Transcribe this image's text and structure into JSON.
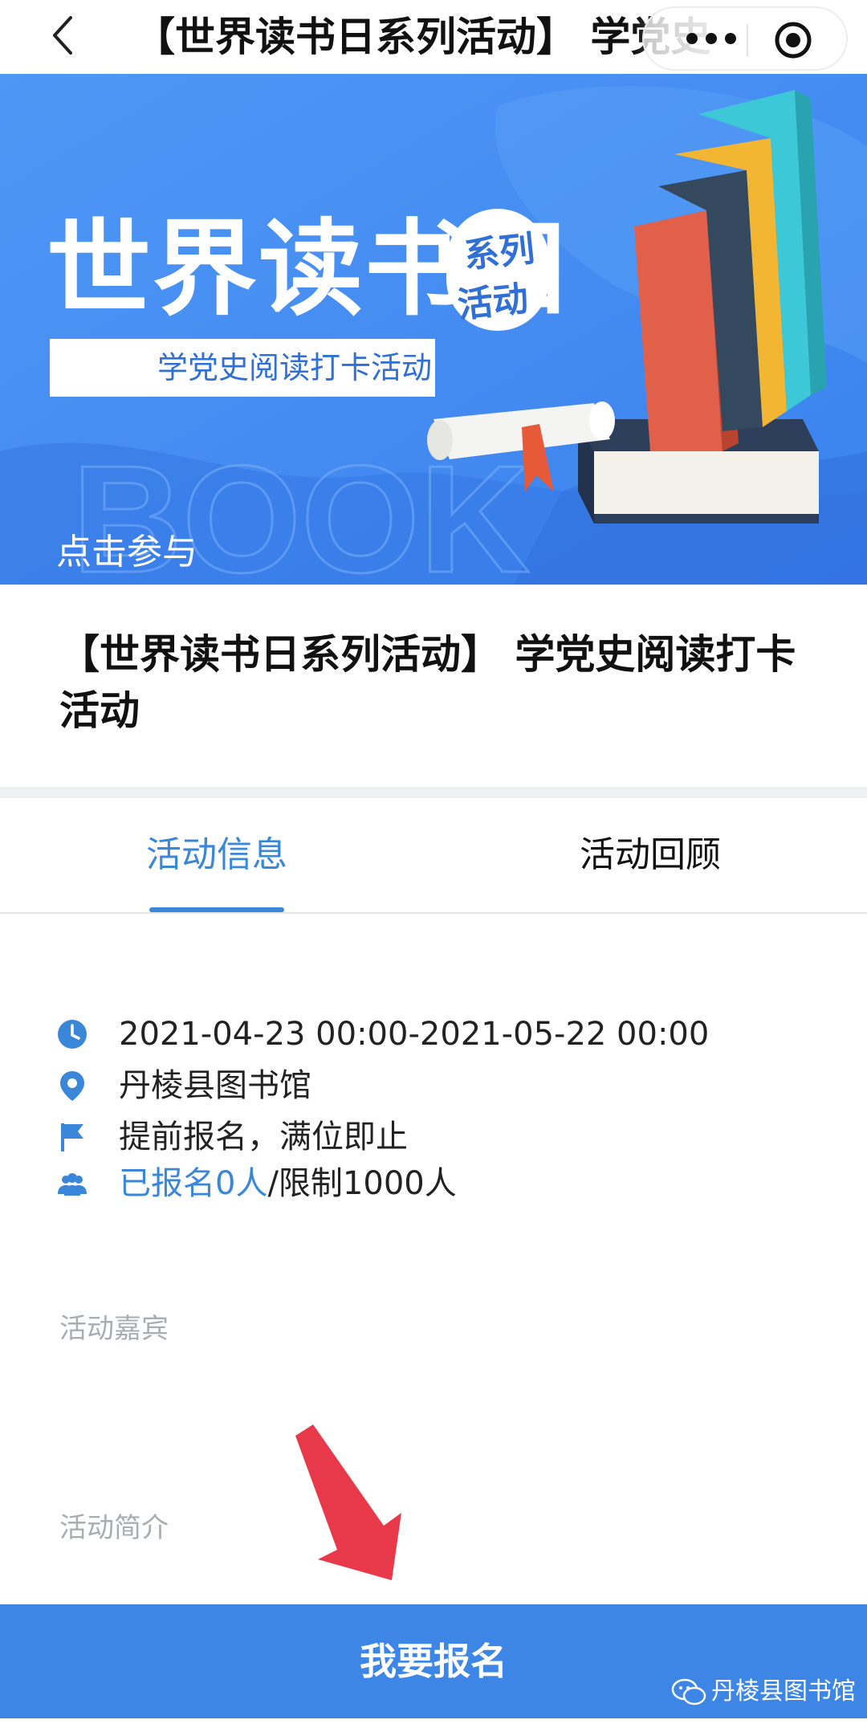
{
  "navbar": {
    "title": "【世界读书日系列活动】 学党史",
    "back_icon": "chevron-left-icon",
    "more_icon": "more-dots-icon",
    "close_icon": "target-close-icon"
  },
  "banner": {
    "headline": "世界读书日",
    "badge_line1": "系列",
    "badge_line2": "活动",
    "subtitle": "学党史阅读打卡活动",
    "cta": "点击参与",
    "bg_word": "BOOK",
    "colors": {
      "background": "#3f8cf3",
      "accent_white": "#ffffff"
    }
  },
  "activity": {
    "title": "【世界读书日系列活动】 学党史阅读打卡活动"
  },
  "tabs": [
    {
      "label": "活动信息",
      "active": true
    },
    {
      "label": "活动回顾",
      "active": false
    }
  ],
  "info": {
    "time": "2021-04-23 00:00-2021-05-22 00:00",
    "place": "丹棱县图书馆",
    "rule": "提前报名，满位即止",
    "registered": "已报名0人",
    "limit": "/限制1000人"
  },
  "sections": {
    "guests_label": "活动嘉宾",
    "intro_label": "活动简介"
  },
  "button": {
    "signup_label": "我要报名"
  },
  "watermark": {
    "text": "丹棱县图书馆",
    "icon": "wechat-icon"
  },
  "colors": {
    "accent_blue": "#3a86d8",
    "button_blue": "#3d86e6",
    "muted_gray": "#a8acb3",
    "arrow_red": "#e8394a"
  }
}
